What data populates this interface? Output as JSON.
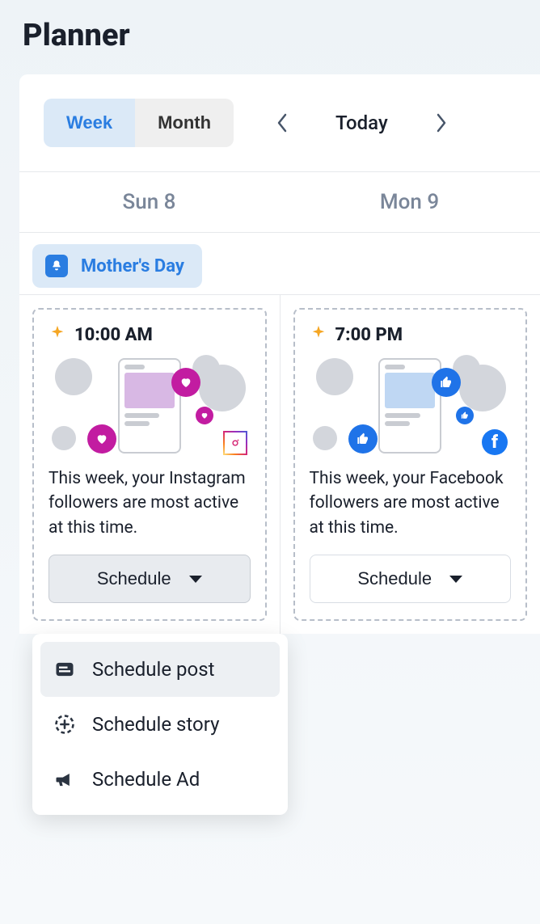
{
  "page": {
    "title": "Planner"
  },
  "toolbar": {
    "view_tabs": {
      "week": "Week",
      "month": "Month"
    },
    "today_label": "Today"
  },
  "calendar": {
    "days": [
      {
        "label": "Sun 8"
      },
      {
        "label": "Mon 9"
      }
    ],
    "event": {
      "name": "Mother's Day"
    }
  },
  "cards": [
    {
      "time": "10:00 AM",
      "platform": "instagram",
      "text": "This week, your Instagram followers are most active at this time.",
      "schedule_label": "Schedule",
      "menu_open": true
    },
    {
      "time": "7:00 PM",
      "platform": "facebook",
      "text": "This week, your Facebook followers are most active at this time.",
      "schedule_label": "Schedule",
      "menu_open": false
    }
  ],
  "dropdown": {
    "items": [
      {
        "label": "Schedule post"
      },
      {
        "label": "Schedule story"
      },
      {
        "label": "Schedule Ad"
      }
    ]
  }
}
